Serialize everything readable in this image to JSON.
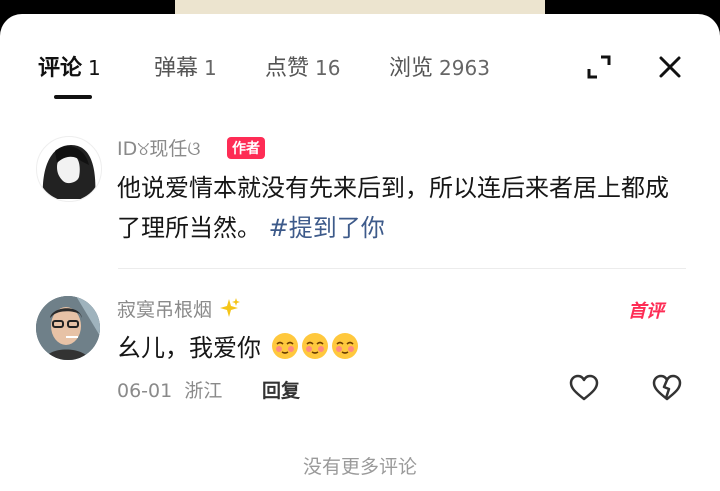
{
  "tabs": [
    {
      "label": "评论",
      "count": "1"
    },
    {
      "label": "弹幕",
      "count": "1"
    },
    {
      "label": "点赞",
      "count": "16"
    },
    {
      "label": "浏览",
      "count": "2963"
    }
  ],
  "comments": [
    {
      "username": "ID୪现任ଓ",
      "badge": "作者",
      "text": "他说爱情本就没有先来后到，所以连后来者居上都成了理所当然。",
      "hashtag": "#提到了你"
    },
    {
      "username": "寂寞吊根烟",
      "name_suffix_icon": "sparkles-icon",
      "first_badge": "首评",
      "text": "幺儿，我爱你",
      "emojis": [
        "blush-emoji",
        "blush-emoji",
        "blush-emoji"
      ],
      "date": "06-01",
      "location": "浙江",
      "reply_label": "回复"
    }
  ],
  "footer": {
    "no_more": "没有更多评论"
  },
  "colors": {
    "accent": "#fe2c55",
    "hashtag": "#3d5a8a"
  }
}
